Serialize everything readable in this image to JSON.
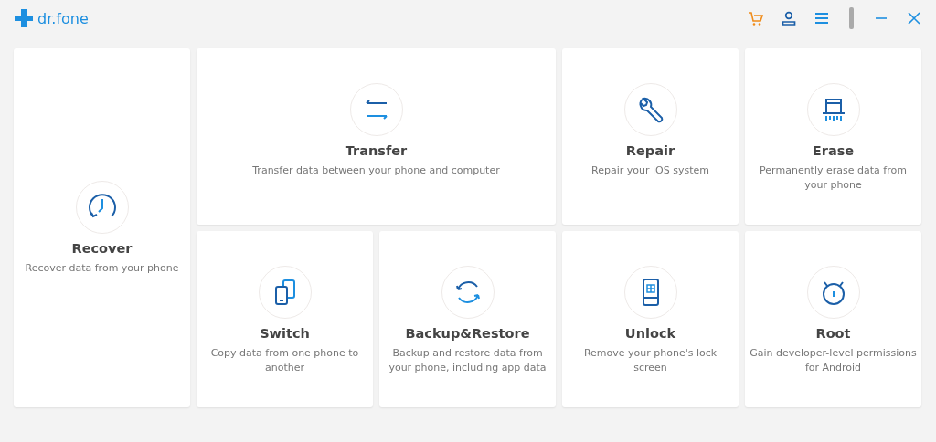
{
  "app": {
    "name": "dr.fone"
  },
  "cards": [
    {
      "kind": "recover",
      "title": "Recover",
      "description": "Recover data from your phone"
    },
    {
      "kind": "transfer",
      "title": "Transfer",
      "description": "Transfer data between your phone and computer"
    },
    {
      "kind": "repair",
      "title": "Repair",
      "description": "Repair your iOS system"
    },
    {
      "kind": "erase",
      "title": "Erase",
      "description": "Permanently erase data from your phone"
    },
    {
      "kind": "switch",
      "title": "Switch",
      "description": "Copy data from one phone to another"
    },
    {
      "kind": "backup",
      "title": "Backup&Restore",
      "description": "Backup and restore data from your phone, including app data"
    },
    {
      "kind": "unlock",
      "title": "Unlock",
      "description": "Remove your phone's lock screen"
    },
    {
      "kind": "root",
      "title": "Root",
      "description": "Gain developer-level permissions for Android"
    }
  ]
}
